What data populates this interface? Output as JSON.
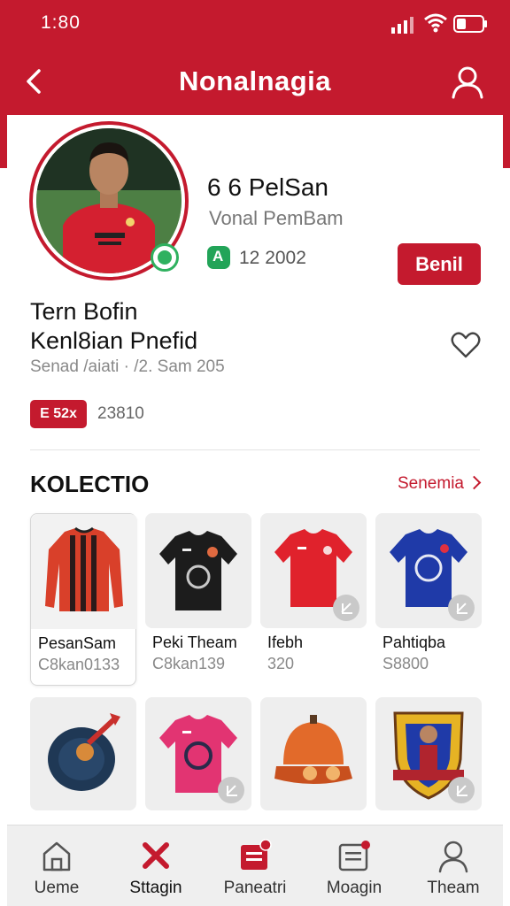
{
  "status_bar": {
    "time": "1:80"
  },
  "header": {
    "title": "Nonalnagia",
    "back_icon": "chevron-left-icon",
    "profile_icon": "user-icon"
  },
  "profile": {
    "name": "6 6 PelSan",
    "subtitle": "Vonal PemBam",
    "badge_text": "12  2002",
    "follow_label": "Benil",
    "title_line1": "Tern Bofin",
    "title_line2": "Kenl8ian Pnefid",
    "meta": "Senad /aiati  · /2. Sam 205",
    "tag_label": "E 52x",
    "tag_count": "23810"
  },
  "collection": {
    "title": "KOLECTIO",
    "see_all_label": "Senemia",
    "items": [
      {
        "label": "PesanSam",
        "price": "C8kan0133",
        "icon": "striped-jersey"
      },
      {
        "label": "Peki Theam",
        "price": "C8kan139",
        "icon": "black-jersey"
      },
      {
        "label": "Ifebh",
        "price": "320",
        "icon": "red-jersey"
      },
      {
        "label": "Pahtiqba",
        "price": "S8800",
        "icon": "blue-jersey"
      },
      {
        "label": "",
        "price": "",
        "icon": "cap"
      },
      {
        "label": "",
        "price": "",
        "icon": "pink-jersey"
      },
      {
        "label": "",
        "price": "",
        "icon": "orange-helmet"
      },
      {
        "label": "",
        "price": "",
        "icon": "team-crest"
      }
    ]
  },
  "bottom_nav": [
    {
      "label": "Ueme",
      "icon": "home-icon"
    },
    {
      "label": "Sttagin",
      "icon": "close-icon"
    },
    {
      "label": "Paneatri",
      "icon": "document-icon"
    },
    {
      "label": "Moagin",
      "icon": "message-icon"
    },
    {
      "label": "Theam",
      "icon": "person-icon"
    }
  ],
  "colors": {
    "accent": "#c41a2e",
    "online": "#2fb15f",
    "badge": "#22a458"
  }
}
